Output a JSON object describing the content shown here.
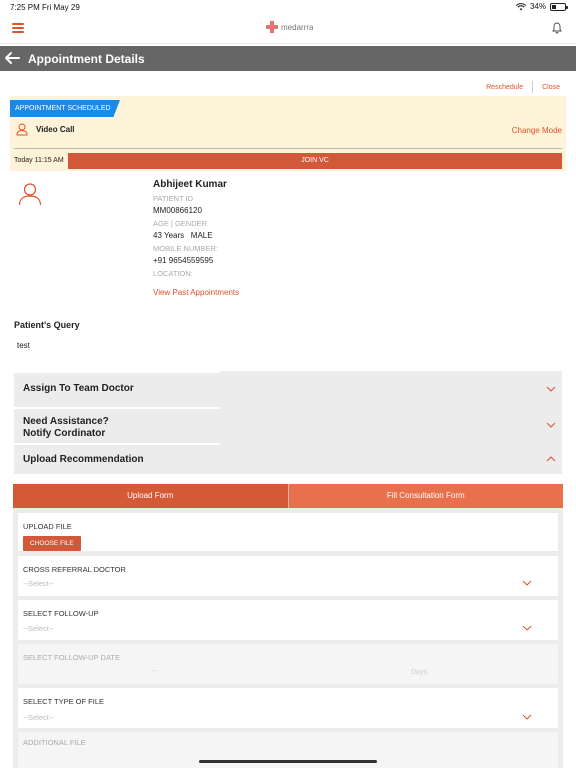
{
  "status_bar": {
    "time": "7:25 PM",
    "date": "Fri May 29",
    "battery": "34%",
    "battery_level": 0.34
  },
  "header": {
    "logo_text": "medarrra"
  },
  "title_bar": {
    "title": "Appointment Details"
  },
  "actions": {
    "reschedule": "Reschedule",
    "close": "Close"
  },
  "appointment": {
    "status_badge": "APPOINTMENT SCHEDULED",
    "mode": "Video Call",
    "change_mode": "Change Mode",
    "time": "Today 11:15 AM",
    "join_label": "JOIN VC"
  },
  "patient": {
    "name": "Abhijeet Kumar",
    "id_label": "PATIENT ID",
    "id": "MM00866120",
    "age_gender_label": "AGE | GENDER",
    "age_gender": "43 Years   MALE",
    "mobile_label": "MOBILE NUMBER:",
    "mobile": "+91 9654559595",
    "location_label": "LOCATION:",
    "location": "",
    "past_link": "View Past Appointments"
  },
  "query": {
    "title": "Patient's Query",
    "text": "test"
  },
  "accordions": {
    "assign": "Assign To Team Doctor",
    "assist_line1": "Need Assistance?",
    "assist_line2": "Notify Cordinator",
    "upload": "Upload Recommendation"
  },
  "tabs": {
    "upload_form": "Upload Form",
    "consultation_form": "Fill Consultation Form"
  },
  "form": {
    "upload_file": {
      "label": "UPLOAD FILE",
      "button": "CHOOSE FILE"
    },
    "cross_referral": {
      "label": "CROSS REFERRAL DOCTOR",
      "placeholder": "--Select--"
    },
    "follow_up": {
      "label": "SELECT FOLLOW-UP",
      "placeholder": "--Select--"
    },
    "follow_up_date": {
      "label": "SELECT FOLLOW-UP DATE",
      "value": "--",
      "unit": "Days"
    },
    "file_type": {
      "label": "SELECT TYPE OF FILE",
      "placeholder": "--Select--"
    },
    "additional_file": {
      "label": "ADDITIONAL FILE"
    }
  },
  "colors": {
    "accent": "#e2522b",
    "badge_blue": "#1e88e5",
    "title_bar": "#666666",
    "appointment_bg": "#fdf3d9"
  }
}
